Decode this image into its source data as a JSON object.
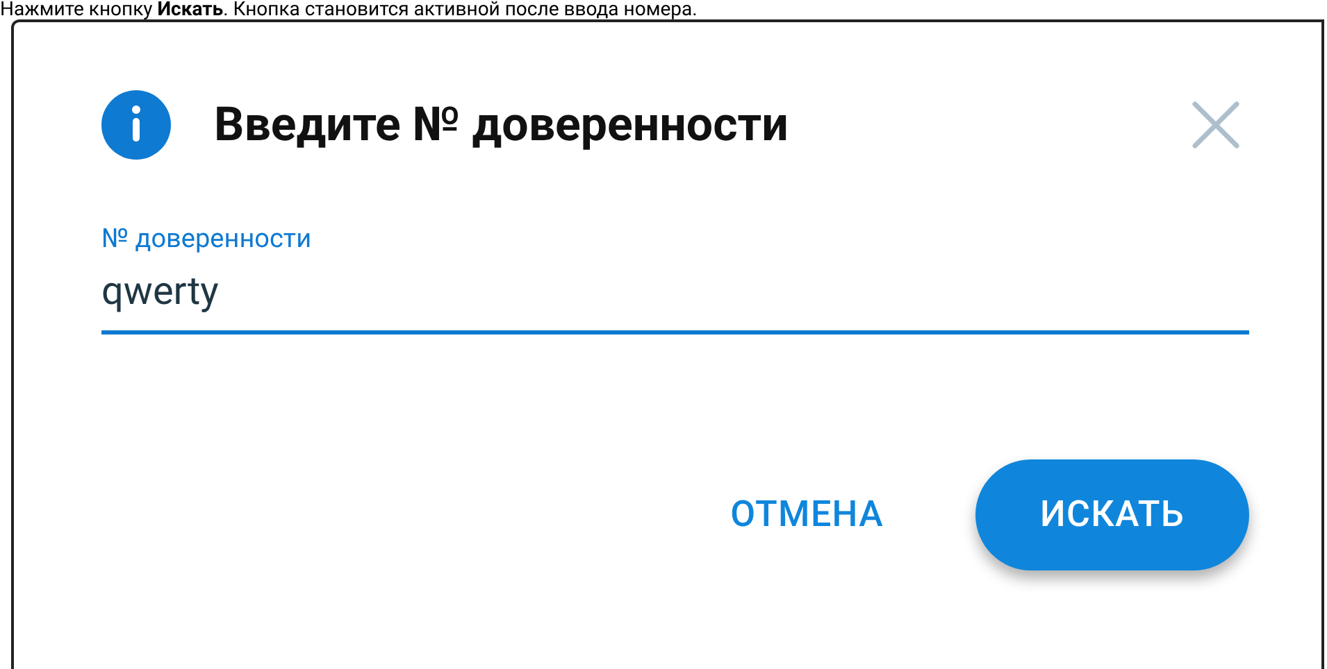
{
  "instruction": "Нажмите кнопку **Искать**. Кнопка становится активной после ввода номера.",
  "dialog": {
    "title": "Введите № доверенности",
    "field": {
      "label": "№ доверенности",
      "value": "qwerty",
      "focused": true
    },
    "buttons": [
      {
        "label": "ОТМЕНА",
        "kind": "text"
      },
      {
        "label": "ИСКАТЬ",
        "kind": "primary"
      }
    ]
  }
}
